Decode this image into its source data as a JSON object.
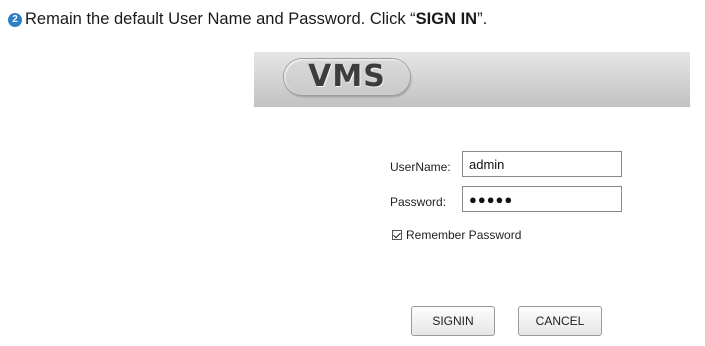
{
  "instruction": {
    "step_number": "2",
    "text_before": "Remain the default User Name and Password. Click “",
    "bold": "SIGN IN",
    "text_after": "”."
  },
  "dialog": {
    "logo": "VMS",
    "username_label": "UserName:",
    "username_value": "admin",
    "password_label": "Password:",
    "password_value": "●●●●●",
    "remember_label": "Remember Password",
    "remember_checked": true,
    "signin_label": "SIGNIN",
    "cancel_label": "CANCEL"
  }
}
